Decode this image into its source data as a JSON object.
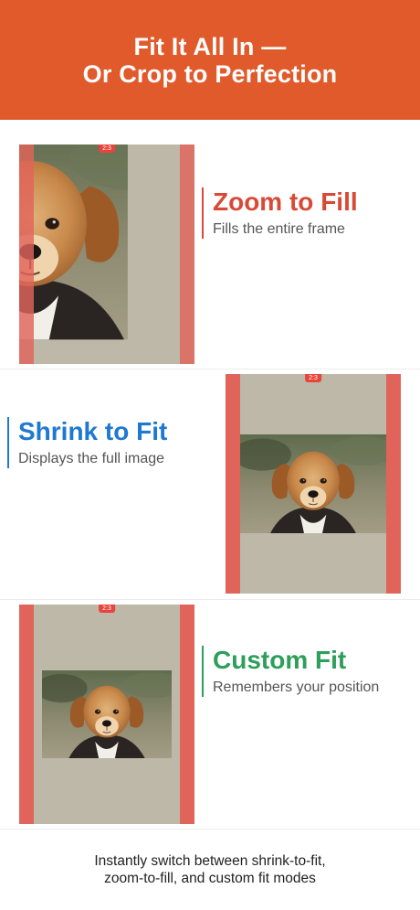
{
  "header": {
    "title_line1": "Fit It All In —",
    "title_line2": "Or Crop to Perfection",
    "background_color": "#e05a2b"
  },
  "frame_badge": "2:3",
  "modes": [
    {
      "title": "Zoom to Fill",
      "subtitle": "Fills the entire frame",
      "accent_color": "#d84a36"
    },
    {
      "title": "Shrink to Fit",
      "subtitle": "Displays the full image",
      "accent_color": "#1f78d1"
    },
    {
      "title": "Custom Fit",
      "subtitle": "Remembers your position",
      "accent_color": "#2e9e5b"
    }
  ],
  "footer": {
    "line1": "Instantly switch between shrink-to-fit,",
    "line2": "zoom-to-fill, and custom fit modes"
  },
  "colors": {
    "frame_bar": "#e0645a",
    "frame_fill": "#bdb8a7",
    "badge": "#e8443c"
  }
}
